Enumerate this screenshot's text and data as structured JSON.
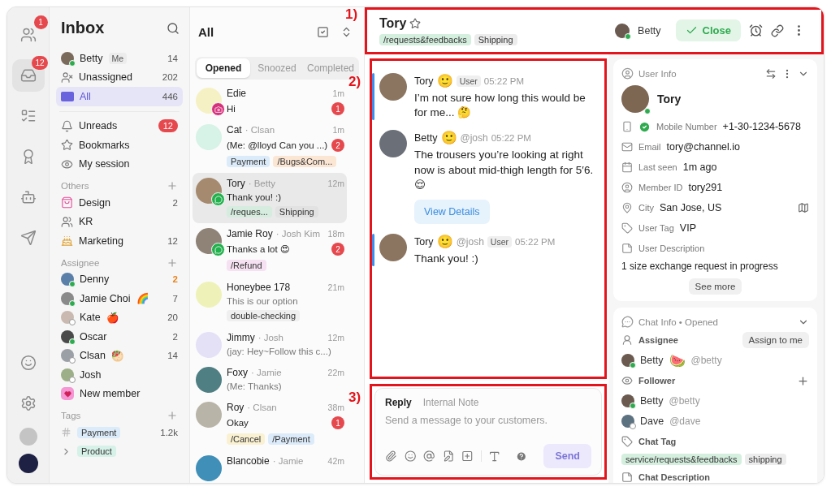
{
  "rail": {
    "items": [
      {
        "kind": "people",
        "badge": "1",
        "selected": false
      },
      {
        "kind": "inbox",
        "badge": "12",
        "selected": true
      },
      {
        "kind": "list",
        "selected": false
      },
      {
        "kind": "award",
        "selected": false
      },
      {
        "kind": "bot",
        "selected": false
      },
      {
        "kind": "send",
        "selected": false
      }
    ],
    "bottom": [
      {
        "kind": "smile"
      },
      {
        "kind": "gear"
      },
      {
        "kind": "avatar"
      },
      {
        "kind": "logo"
      }
    ]
  },
  "sidebar": {
    "title": "Inbox",
    "primary": [
      {
        "kind": "avatar",
        "label": "Betty",
        "tag": "Me",
        "count": "14",
        "selected": false
      },
      {
        "kind": "unassigned",
        "label": "Unassigned",
        "count": "202",
        "selected": false
      },
      {
        "kind": "all",
        "label": "All",
        "count": "446",
        "selected": true
      }
    ],
    "views": [
      {
        "kind": "bell",
        "label": "Unreads",
        "badge": "12"
      },
      {
        "kind": "star",
        "label": "Bookmarks"
      },
      {
        "kind": "eye",
        "label": "My session"
      }
    ],
    "others": {
      "heading": "Others",
      "items": [
        {
          "kind": "bag",
          "label": "Design",
          "count": "2"
        },
        {
          "kind": "people",
          "label": "KR"
        },
        {
          "kind": "cake",
          "label": "Marketing",
          "count": "12"
        }
      ]
    },
    "assignee": {
      "heading": "Assignee",
      "items": [
        {
          "kind": "member",
          "label": "Denny",
          "count": "2",
          "highlighted": true,
          "online": true,
          "color": "#5a7fa8"
        },
        {
          "kind": "member",
          "label": "Jamie Choi",
          "emoji": "🌈",
          "count": "7",
          "highlighted": false,
          "online": true,
          "color": "#8a8a8a"
        },
        {
          "kind": "member",
          "label": "Kate",
          "emoji": "🍎",
          "count": "20",
          "highlighted": false,
          "online": false,
          "color": "#c9b9b0"
        },
        {
          "kind": "member",
          "label": "Oscar",
          "count": "2",
          "highlighted": false,
          "online": true,
          "color": "#4a4a4a"
        },
        {
          "kind": "member",
          "label": "Clsan",
          "emoji": "🥙",
          "count": "14",
          "highlighted": false,
          "online": false,
          "color": "#9aa0a6"
        },
        {
          "kind": "member",
          "label": "Josh",
          "online": false,
          "color": "#9caf88"
        },
        {
          "kind": "invite",
          "label": "New member"
        }
      ]
    },
    "tags": {
      "heading": "Tags",
      "items": [
        {
          "kind": "hash",
          "label": "Payment",
          "count": "1.2k",
          "color": "#dcebf9"
        },
        {
          "kind": "caret",
          "label": "Product",
          "color": "#d6f1e8"
        }
      ]
    }
  },
  "list": {
    "title": "All",
    "tabs": [
      {
        "label": "Opened",
        "selected": true
      },
      {
        "label": "Snoozed",
        "selected": false
      },
      {
        "label": "Completed",
        "selected": false
      }
    ],
    "chats": [
      {
        "name": "Edie",
        "time": "1m",
        "preview": "Hi",
        "unread": "1",
        "read": false,
        "channel": {
          "kind": "instagram"
        },
        "color": "#f6f1c4",
        "selected": false
      },
      {
        "name": "Cat",
        "assignee": "· Clsan",
        "time": "1m",
        "preview": "(Me: @lloyd Can you ...)",
        "unread": "2",
        "read": false,
        "color": "#d7f2e6",
        "selected": false,
        "tags": [
          {
            "label": "Payment",
            "color": "#dcebf9"
          },
          {
            "label": "/Bugs&Com...",
            "color": "#fbe6d4"
          }
        ]
      },
      {
        "name": "Tory",
        "assignee": "· Betty",
        "time": "12m",
        "preview": "Thank you! :)",
        "read": false,
        "channel": {
          "kind": "line"
        },
        "color": "#a58a6f",
        "selected": true,
        "tags": [
          {
            "label": "/reques...",
            "color": "#d5ecdf"
          },
          {
            "label": "Shipping",
            "color": "#e2e2e2"
          }
        ]
      },
      {
        "name": "Jamie Roy",
        "assignee": "· Josh Kim",
        "time": "18m",
        "preview": "Thanks a lot 😍",
        "unread": "2",
        "read": false,
        "channel": {
          "kind": "line"
        },
        "color": "#8f8377",
        "selected": false,
        "tags": [
          {
            "label": "/Refund",
            "color": "#f6e1f2"
          }
        ]
      },
      {
        "name": "Honeybee 178",
        "time": "21m",
        "preview": "This is our option",
        "read": true,
        "color": "#eef2b8",
        "selected": false,
        "tags": [
          {
            "label": "double-checking",
            "color": "#efefef"
          }
        ]
      },
      {
        "name": "Jimmy",
        "assignee": "· Josh",
        "time": "12m",
        "preview": "(jay: Hey~Follow this c...)",
        "read": true,
        "color": "#e4e1f7",
        "selected": false
      },
      {
        "name": "Foxy",
        "assignee": "· Jamie",
        "time": "22m",
        "preview": "(Me: Thanks)",
        "read": true,
        "color": "#4f7f83",
        "selected": false
      },
      {
        "name": "Roy",
        "assignee": "· Clsan",
        "time": "38m",
        "preview": "Okay",
        "unread": "1",
        "read": false,
        "color": "#b9b4a8",
        "selected": false,
        "tags": [
          {
            "label": "/Cancel",
            "color": "#faf1d2"
          },
          {
            "label": "/Payment",
            "color": "#dcebf9"
          }
        ]
      },
      {
        "name": "Blancobie",
        "assignee": "· Jamie",
        "time": "42m",
        "color": "#3f8fb8",
        "selected": false
      }
    ]
  },
  "header": {
    "name": "Tory",
    "starred": false,
    "annotation": "1)",
    "tags": [
      {
        "label": "/requests&feedbacks",
        "color": "#d5efdf"
      },
      {
        "label": "Shipping",
        "color": "#ececec"
      }
    ],
    "assignee": "Betty",
    "close": "Close"
  },
  "messages": {
    "annotation": "2)",
    "items": [
      {
        "kind": "user",
        "name": "Tory",
        "emoji": "🙂",
        "role": "User",
        "time": "05:22 PM",
        "text": "I’m not sure how long this would be for me... 🤔"
      },
      {
        "kind": "manager",
        "name": "Betty",
        "emoji": "🙂",
        "handle": "@josh",
        "time": "05:22 PM",
        "text": "The trousers you’re looking at right now is about mid-thigh length for 5′6. 😌",
        "button": "View Details"
      },
      {
        "kind": "user",
        "name": "Tory",
        "emoji": "🙂",
        "handle": "@josh",
        "role": "User",
        "time": "05:22 PM",
        "text": "Thank you! :)"
      }
    ]
  },
  "composer": {
    "annotation": "3)",
    "tabs": [
      {
        "label": "Reply",
        "selected": true
      },
      {
        "label": "Internal Note",
        "selected": false
      }
    ],
    "placeholder": "Send a message to your customers.",
    "tools": [
      {
        "kind": "attach"
      },
      {
        "kind": "emoji"
      },
      {
        "kind": "mention"
      },
      {
        "kind": "template"
      },
      {
        "kind": "add"
      },
      {
        "kind": "text"
      }
    ],
    "send": "Send",
    "send_disabled": true
  },
  "user_info": {
    "title": "User Info",
    "name": "Tory",
    "fields": [
      {
        "kind": "phone",
        "label": "Mobile Number",
        "value": "+1-30-1234-5678",
        "verified": true
      },
      {
        "kind": "email",
        "label": "Email",
        "value": "tory@channel.io",
        "verified": false
      },
      {
        "kind": "calendar",
        "label": "Last seen",
        "value": "1m ago",
        "verified": false
      },
      {
        "kind": "member",
        "label": "Member ID",
        "value": "tory291",
        "verified": false
      },
      {
        "kind": "location",
        "label": "City",
        "value": "San Jose, US",
        "verified": false
      },
      {
        "kind": "tag",
        "label": "User Tag",
        "value": "VIP",
        "verified": false
      },
      {
        "kind": "note",
        "label": "User Description",
        "value": "1 size exchange request in progress",
        "verified": false
      }
    ],
    "see_more": "See more"
  },
  "chat_info": {
    "title": "Chat Info • Opened",
    "assignee_label": "Assignee",
    "assign_button": "Assign to me",
    "assignee": {
      "name": "Betty",
      "emoji": "🍉",
      "handle": "@betty",
      "online": true
    },
    "follower_label": "Follower",
    "followers": [
      {
        "name": "Betty",
        "handle": "@betty",
        "online": true
      },
      {
        "name": "Dave",
        "handle": "@dave",
        "online": false
      }
    ],
    "tag_label": "Chat Tag",
    "tags": [
      {
        "label": "service/requests&feedbacks",
        "color": "#d5efdf"
      },
      {
        "label": "shipping",
        "color": "#ececec"
      }
    ],
    "description_label": "Chat Description"
  }
}
